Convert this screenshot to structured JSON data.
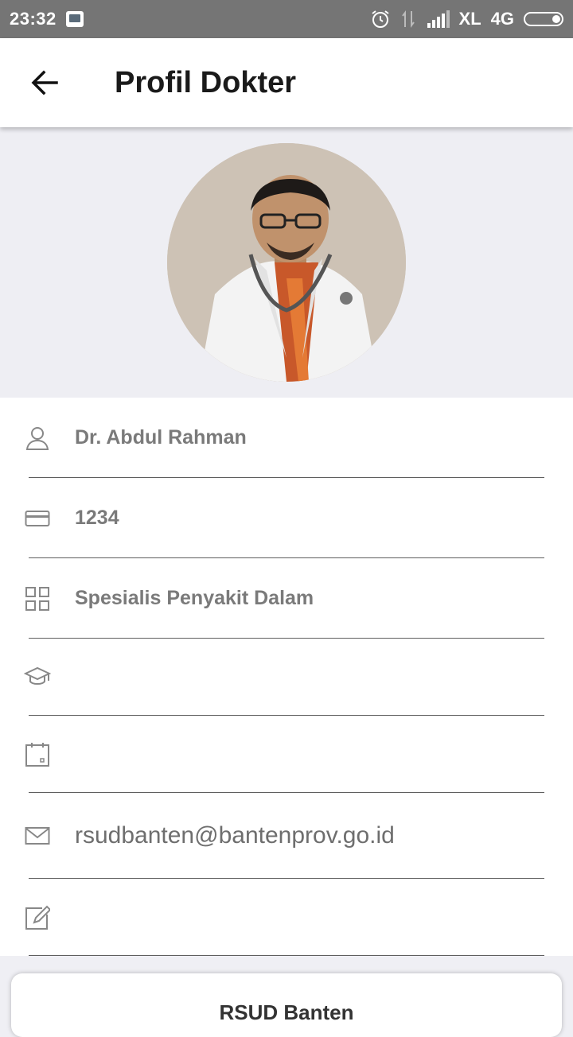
{
  "status_bar": {
    "time": "23:32",
    "carrier": "XL",
    "network": "4G",
    "icons": [
      "bbm-icon",
      "alarm-icon",
      "data-arrows-icon",
      "signal-icon",
      "battery-icon"
    ]
  },
  "app_bar": {
    "title": "Profil Dokter",
    "back_icon": "arrow-back-icon"
  },
  "profile": {
    "photo": "doctor-photo"
  },
  "fields": [
    {
      "icon": "person-icon",
      "value": "Dr. Abdul Rahman"
    },
    {
      "icon": "card-icon",
      "value": "1234"
    },
    {
      "icon": "grid-icon",
      "value": "Spesialis Penyakit Dalam"
    },
    {
      "icon": "graduation-cap-icon",
      "value": ""
    },
    {
      "icon": "calendar-icon",
      "value": ""
    },
    {
      "icon": "mail-icon",
      "value": "rsudbanten@bantenprov.go.id"
    },
    {
      "icon": "edit-icon",
      "value": ""
    }
  ],
  "hospital_card": {
    "title": "RSUD Banten"
  },
  "colors": {
    "status_bar": "#757575",
    "background": "#efeff4",
    "text_muted": "#7a7a7a",
    "divider": "#5e5e5e"
  }
}
